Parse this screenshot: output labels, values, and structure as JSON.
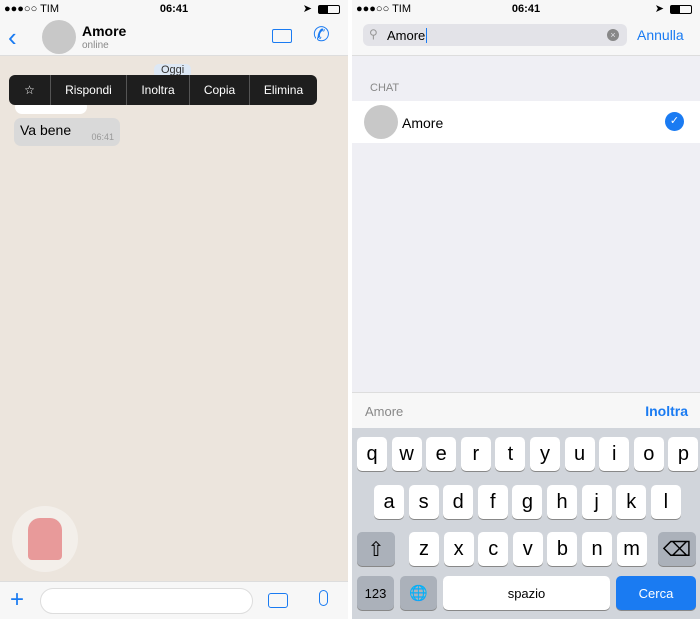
{
  "status": {
    "carrier": "TIM",
    "time": "06:41"
  },
  "chat": {
    "contact": "Amore",
    "subtitle": "online",
    "date_badge": "Oggi",
    "context_menu": [
      "☆",
      "Rispondi",
      "Inoltra",
      "Copia",
      "Elimina"
    ],
    "messages": [
      {
        "text": "Va bene",
        "time": "06:41"
      }
    ]
  },
  "search": {
    "value": "Amore",
    "cancel": "Annulla",
    "section": "CHAT",
    "results": [
      {
        "name": "Amore",
        "selected": true
      }
    ]
  },
  "forward_bar": {
    "recipients": "Amore",
    "action": "Inoltra"
  },
  "keyboard": {
    "row1": [
      "q",
      "w",
      "e",
      "r",
      "t",
      "y",
      "u",
      "i",
      "o",
      "p"
    ],
    "row2": [
      "a",
      "s",
      "d",
      "f",
      "g",
      "h",
      "j",
      "k",
      "l"
    ],
    "row3": [
      "z",
      "x",
      "c",
      "v",
      "b",
      "n",
      "m"
    ],
    "numbers": "123",
    "space": "spazio",
    "return": "Cerca"
  },
  "colors": {
    "accent": "#1a7bf2",
    "chat_bg": "#ece5dd"
  }
}
